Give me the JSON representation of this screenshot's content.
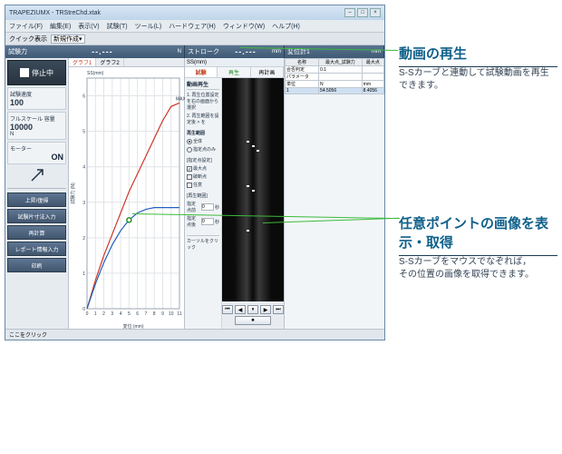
{
  "window": {
    "title": "TRAPEZIUMX - TRStreChd.xtak",
    "btn_min": "–",
    "btn_max": "□",
    "btn_close": "×"
  },
  "menu": [
    "ファイル(F)",
    "編集(E)",
    "表示(V)",
    "試験(T)",
    "ツール(L)",
    "ハードウェア(H)",
    "ウィンドウ(W)",
    "ヘルプ(H)"
  ],
  "toolbar": {
    "quick_label": "クイック表示",
    "combo": "新規作成",
    "chev": "▾"
  },
  "header_cells": [
    {
      "label": "試験力",
      "val": "--.---",
      "unit": "N"
    },
    {
      "label": "ストローク",
      "val": "--.---",
      "unit": "mm"
    },
    {
      "label": "変位計1",
      "val": "",
      "unit": "mm"
    }
  ],
  "left": {
    "stop": "停止中",
    "speed_label": "試験速度",
    "speed_val": "100",
    "scale_label": "フルスケール 容量",
    "scale_val": "10000",
    "scale_unit": "N",
    "motor": "モーター",
    "on": "ON",
    "btns": [
      "上昇/復帰",
      "試験片寸法入力",
      "再計算",
      "レポート情報入力",
      "印刷"
    ]
  },
  "chart": {
    "tabs": [
      "グラフ1",
      "グラフ2"
    ],
    "title": "SS(mm)",
    "ylabel": "試験力 (N)",
    "xlabel": "変位 (mm)",
    "max_label": "MAX",
    "cursor_label": "カーソルをクリック"
  },
  "chart_data": {
    "type": "line",
    "x": [
      0,
      1,
      2,
      3,
      4,
      5,
      6,
      7,
      8,
      9,
      10,
      11
    ],
    "xticks": [
      0,
      1,
      2,
      3,
      4,
      5,
      6,
      7,
      8,
      9,
      10,
      11
    ],
    "yticks": [
      0,
      1,
      2,
      3,
      4,
      5,
      6
    ],
    "ylim": [
      0,
      6.5
    ],
    "series": [
      {
        "name": "red",
        "color": "#d03828",
        "values": [
          0,
          0.8,
          1.5,
          2.1,
          2.7,
          3.3,
          3.8,
          4.3,
          4.8,
          5.3,
          5.7,
          5.8
        ]
      },
      {
        "name": "blue",
        "color": "#2060c0",
        "values": [
          0,
          0.7,
          1.3,
          1.8,
          2.2,
          2.5,
          2.7,
          2.8,
          2.85,
          2.85,
          2.85,
          2.85
        ]
      }
    ],
    "marker": {
      "x": 5,
      "y": 2.5
    }
  },
  "video": {
    "subtabs": [
      "試験",
      "再生",
      "再計画"
    ],
    "section1": "動画再生",
    "note1": "1. 再生位置設定を右の画面から選択",
    "note2": "2. 再生範囲を設定後 > を",
    "radios_label": "再生範囲",
    "radio1": "全体",
    "radio2": "指定点のみ",
    "sec2": "[指定点設定]",
    "field1": "最大点",
    "field2": "破断点",
    "field3": "任意",
    "sec3": "[再生範囲]",
    "f_before": "指定点前",
    "f_before_unit": "秒",
    "f_after": "指定点後",
    "f_after_unit": "秒",
    "val_bef": "0",
    "val_aft": "0"
  },
  "playback": {
    "r1": "⏮",
    "r2": "◀",
    "r3": "⏸",
    "r4": "▶",
    "r5": "⏭",
    "r6": "⏹"
  },
  "data": {
    "title": "",
    "cols": [
      "名称",
      "最大点_試験力",
      "最大点"
    ],
    "unitrow": [
      "合否判定",
      "0.1 ",
      ""
    ],
    "paramrow": [
      "パラメータ",
      "",
      ""
    ],
    "unitsrow": [
      "単位",
      "N",
      "mm"
    ],
    "rows": [
      [
        "1",
        "54.5056",
        "8.4056"
      ]
    ]
  },
  "footer": "ここをクリック",
  "anno1": {
    "title": "動画の再生",
    "body": "S-Sカーブと連動して試験動画を再生できます。"
  },
  "anno2": {
    "title": "任意ポイントの画像を表示・取得",
    "body1": "S-Sカーブをマウスでなぞれば，",
    "body2": "その位置の画像を取得できます。"
  }
}
